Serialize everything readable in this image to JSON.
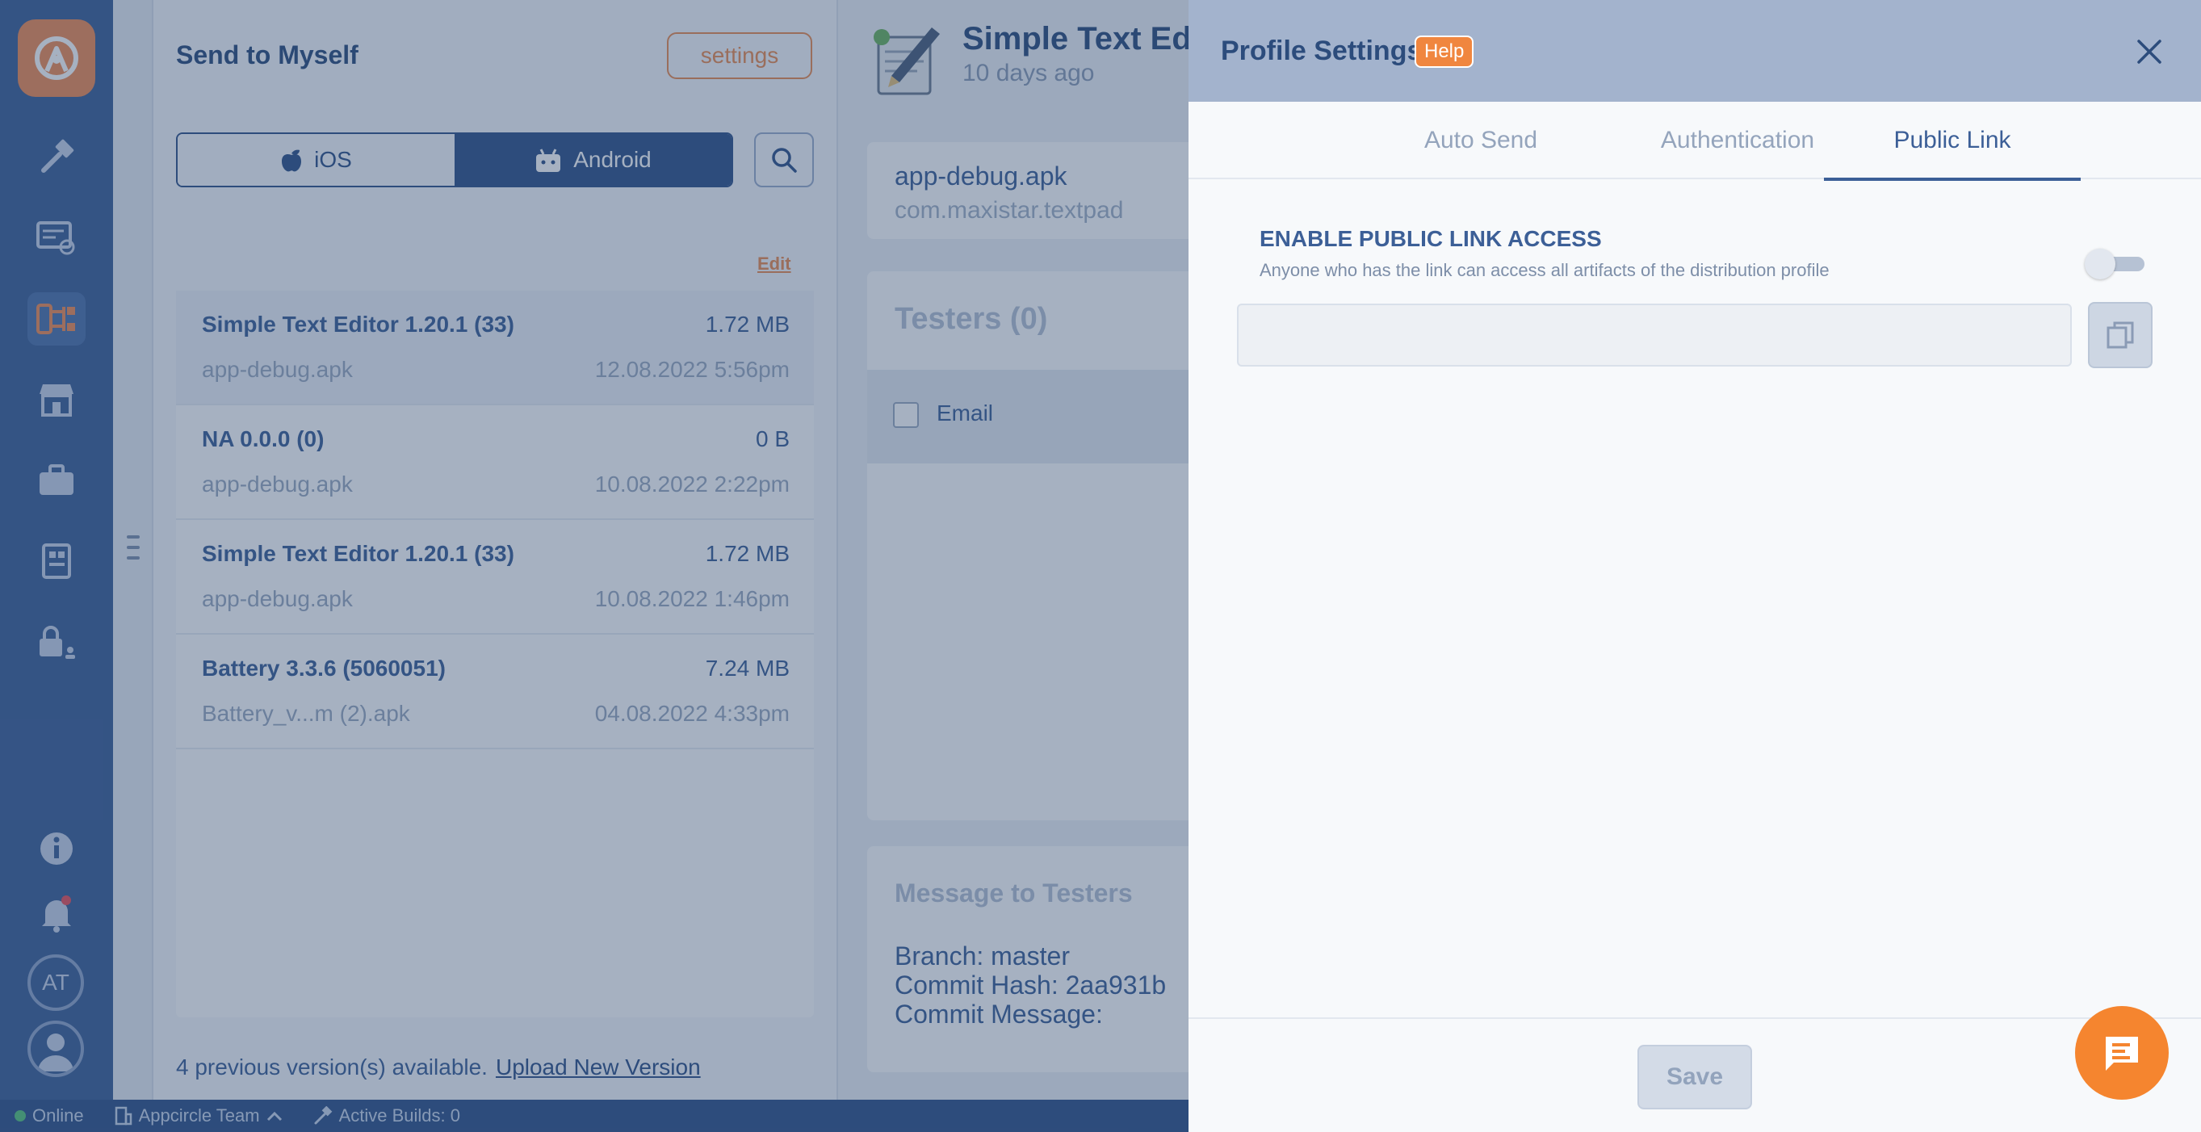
{
  "background": {
    "module_title": "Send to Myself",
    "settings_label": "settings",
    "platform": {
      "ios_label": "iOS",
      "android_label": "Android"
    },
    "edit_label": "Edit",
    "versions": [
      {
        "name": "Simple Text Editor 1.20.1 (33)",
        "size": "1.72 MB",
        "file": "app-debug.apk",
        "date": "12.08.2022 5:56pm",
        "selected": true
      },
      {
        "name": "NA 0.0.0 (0)",
        "size": "0 B",
        "file": "app-debug.apk",
        "date": "10.08.2022 2:22pm",
        "selected": false
      },
      {
        "name": "Simple Text Editor 1.20.1 (33)",
        "size": "1.72 MB",
        "file": "app-debug.apk",
        "date": "10.08.2022 1:46pm",
        "selected": false
      },
      {
        "name": "Battery 3.3.6 (5060051)",
        "size": "7.24 MB",
        "file": "Battery_v...m (2).apk",
        "date": "04.08.2022 4:33pm",
        "selected": false
      }
    ],
    "previous_versions_text": "4 previous version(s) available.",
    "upload_link": "Upload New Version",
    "detail": {
      "app_title": "Simple Text Ed",
      "app_subtitle": "10 days ago",
      "file_name": "app-debug.apk",
      "package_name": "com.maxistar.textpad",
      "testers_title": "Testers (0)",
      "email_header": "Email",
      "message_title": "Message to Testers",
      "message_lines": [
        "Branch: master",
        "Commit Hash: 2aa931b",
        "Commit Message:"
      ]
    }
  },
  "status_bar": {
    "online": "Online",
    "team": "Appcircle Team",
    "active_builds": "Active Builds: 0"
  },
  "rail": {
    "avatar_initials": "AT"
  },
  "panel": {
    "title": "Profile Settings",
    "help_label": "Help",
    "tabs": [
      "Auto Send",
      "Authentication",
      "Public Link"
    ],
    "active_tab": "Public Link",
    "section_title": "ENABLE PUBLIC LINK ACCESS",
    "section_description": "Anyone who has the link can access all artifacts of the distribution profile",
    "public_link_enabled": false,
    "link_value": "",
    "save_label": "Save"
  },
  "colors": {
    "accent_orange": "#f5852f",
    "brand_blue": "#3c5f97",
    "rail_blue": "#3c5f97"
  }
}
